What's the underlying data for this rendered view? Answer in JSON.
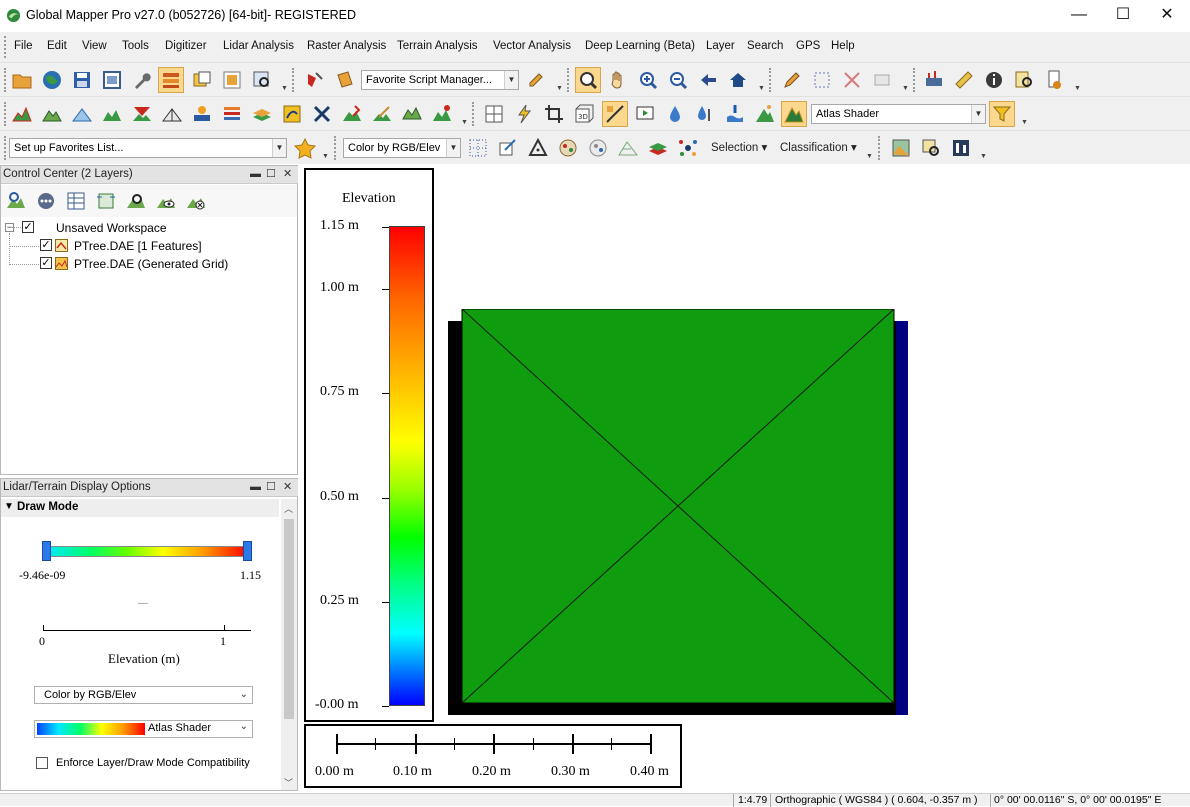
{
  "window": {
    "title": "Global Mapper Pro v27.0 (b052726) [64-bit]- REGISTERED",
    "minimize": "—",
    "maximize": "☐",
    "close": "✕"
  },
  "menu": [
    "File",
    "Edit",
    "View",
    "Tools",
    "Digitizer",
    "Lidar Analysis",
    "Raster Analysis",
    "Terrain Analysis",
    "Vector Analysis",
    "Deep Learning (Beta)",
    "Layer",
    "Search",
    "GPS",
    "Help"
  ],
  "toolbar": {
    "script_combo": "Favorite Script Manager...",
    "shader_combo": "Atlas Shader",
    "favorites_combo": "Set up Favorites List...",
    "color_combo": "Color by RGB/Elev",
    "selection_btn": "Selection",
    "classification_btn": "Classification"
  },
  "control_center": {
    "title": "Control Center (2 Layers)",
    "tree": [
      {
        "label": "Unsaved Workspace",
        "checked": true
      },
      {
        "label": "PTree.DAE [1 Features]",
        "checked": true
      },
      {
        "label": "PTree.DAE (Generated Grid)",
        "checked": true
      }
    ]
  },
  "display_options": {
    "title": "Lidar/Terrain Display Options",
    "section": "Draw Mode",
    "range_min": "-9.46e-09",
    "range_max": "1.15",
    "dash": "—",
    "axis_ticks": [
      "0",
      "1"
    ],
    "axis_label": "Elevation (m)",
    "color_select": "Color by RGB/Elev",
    "shader_select": "Atlas Shader",
    "enforce_label": "Enforce Layer/Draw Mode Compatibility",
    "enforce_checked": false
  },
  "legend": {
    "title": "Elevation",
    "labels": [
      "1.15 m",
      "1.00 m",
      "0.75 m",
      "0.50 m",
      "0.25 m",
      "-0.00 m"
    ]
  },
  "scale_bar": {
    "labels": [
      "0.00 m",
      "0.10 m",
      "0.20 m",
      "0.30 m",
      "0.40 m"
    ]
  },
  "status": {
    "scale": "1:4.79",
    "projection": "Orthographic ( WGS84 ) ( 0.604, -0.357 m )",
    "coords": "0° 00' 00.0116\" S, 0° 00' 00.0195\" E"
  },
  "colors": {
    "raster_fill": "#0f9c0f",
    "raster_shadow": "#000000",
    "raster_edge": "#00007e",
    "chrome": "#f0f0f0",
    "toggle_on": "#fbd88e"
  }
}
